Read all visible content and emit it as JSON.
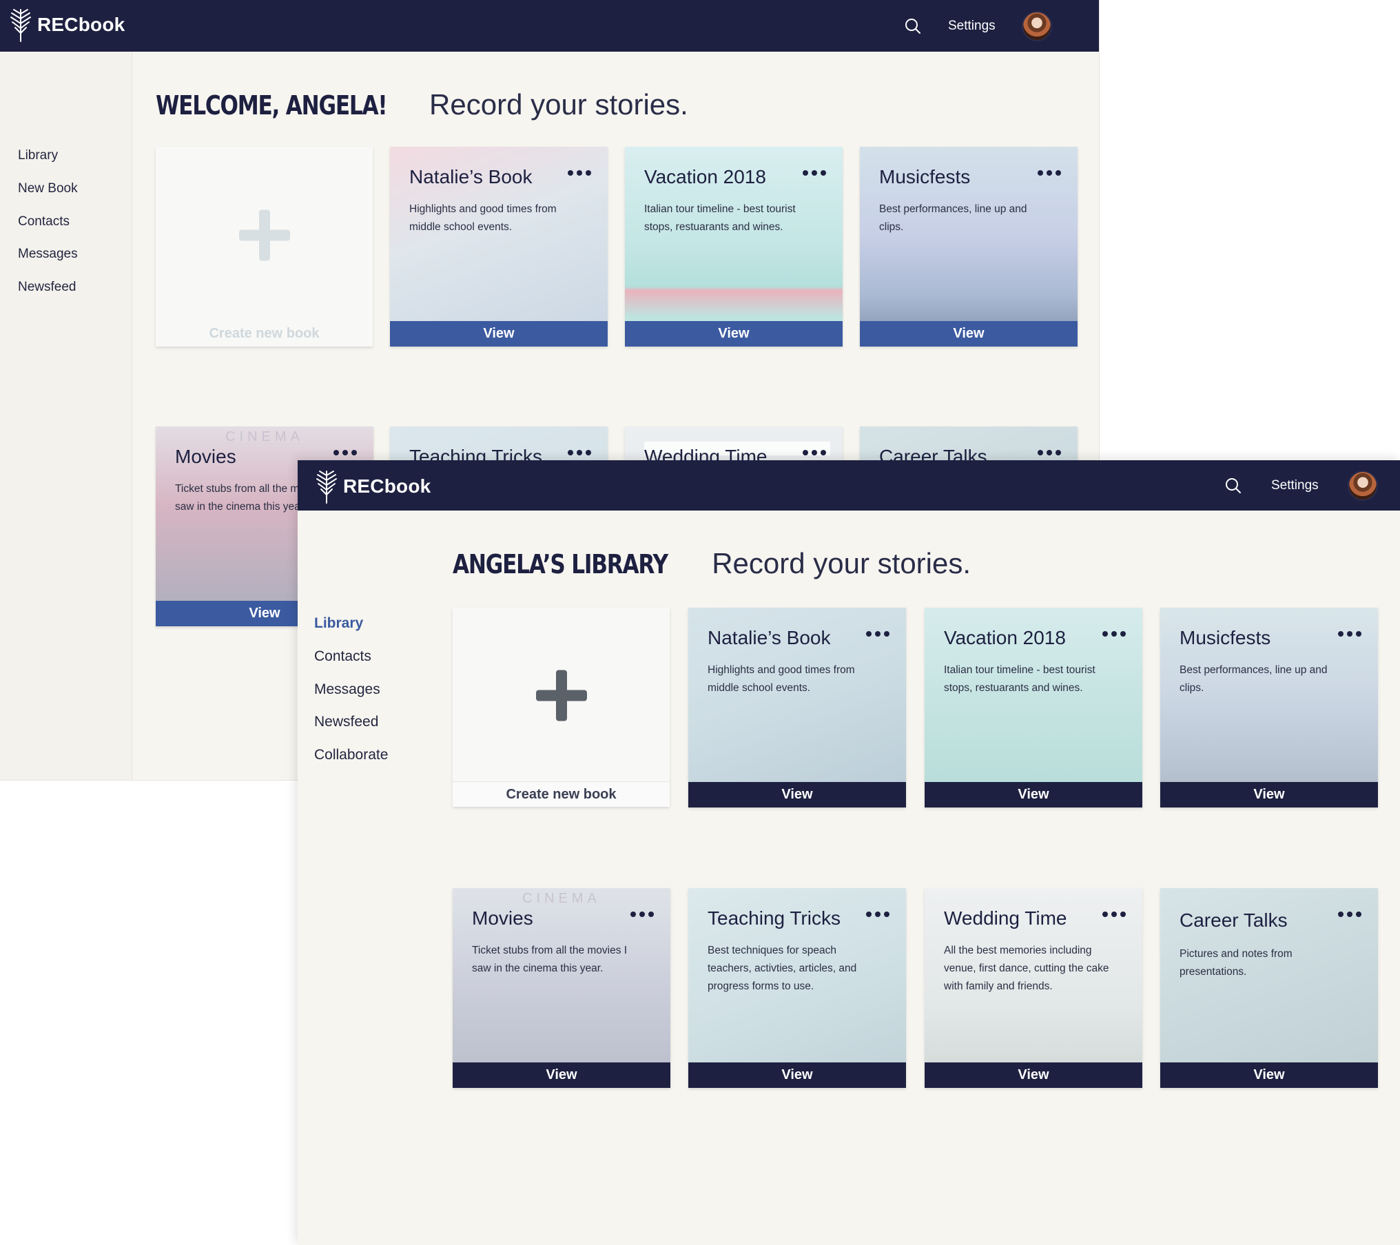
{
  "brand": {
    "name": "RECbook"
  },
  "colors": {
    "navy": "#1d2040",
    "view_blue": "#3b5aa0",
    "active_link": "#3a5a9e",
    "canvas": "#f7f5f0"
  },
  "back": {
    "nav": {
      "settings": "Settings"
    },
    "greeting": {
      "title": "WELCOME, ANGELA!",
      "subtitle": "Record your stories."
    },
    "sidebar": [
      "Library",
      "New Book",
      "Contacts",
      "Messages",
      "Newsfeed"
    ],
    "create_label": "Create new book",
    "books": [
      {
        "title": "Natalie’s Book",
        "desc": "Highlights and good times from middle school events.",
        "view": "View"
      },
      {
        "title": "Vacation 2018",
        "desc": "Italian tour timeline - best tourist stops, restuarants and wines.",
        "view": "View"
      },
      {
        "title": "Musicfests",
        "desc": "Best performances, line up and clips.",
        "view": "View"
      },
      {
        "title": "Movies",
        "desc": "Ticket stubs from all the movies I saw in the cinema this year.",
        "view": "View",
        "sign": "CINEMA"
      },
      {
        "title": "Teaching Tricks"
      },
      {
        "title": "Wedding Time"
      },
      {
        "title": "Career Talks"
      }
    ]
  },
  "front": {
    "nav": {
      "settings": "Settings"
    },
    "greeting": {
      "title": "ANGELA’S LIBRARY",
      "subtitle": "Record your stories."
    },
    "sidebar": [
      "Library",
      "Contacts",
      "Messages",
      "Newsfeed",
      "Collaborate"
    ],
    "active": "Library",
    "create_label": "Create new book",
    "books": [
      {
        "title": "Natalie’s Book",
        "desc": "Highlights and good times from middle school events.",
        "view": "View"
      },
      {
        "title": "Vacation 2018",
        "desc": "Italian tour timeline - best tourist stops, restuarants and wines.",
        "view": "View"
      },
      {
        "title": "Musicfests",
        "desc": "Best performances, line up and clips.",
        "view": "View"
      },
      {
        "title": "Movies",
        "desc": "Ticket stubs from all the movies I saw in the cinema this year.",
        "view": "View",
        "sign": "CINEMA"
      },
      {
        "title": "Teaching Tricks",
        "desc": "Best techniques for speach teachers, activties, articles, and progress forms to use.",
        "view": "View"
      },
      {
        "title": "Wedding Time",
        "desc": "All the best memories including venue, first dance, cutting the cake with family and friends.",
        "view": "View"
      },
      {
        "title": "Career Talks",
        "desc": "Pictures and notes from presentations.",
        "view": "View"
      }
    ]
  },
  "icons": [
    "logo-icon",
    "search-icon",
    "more-icon",
    "plus-icon",
    "avatar"
  ]
}
